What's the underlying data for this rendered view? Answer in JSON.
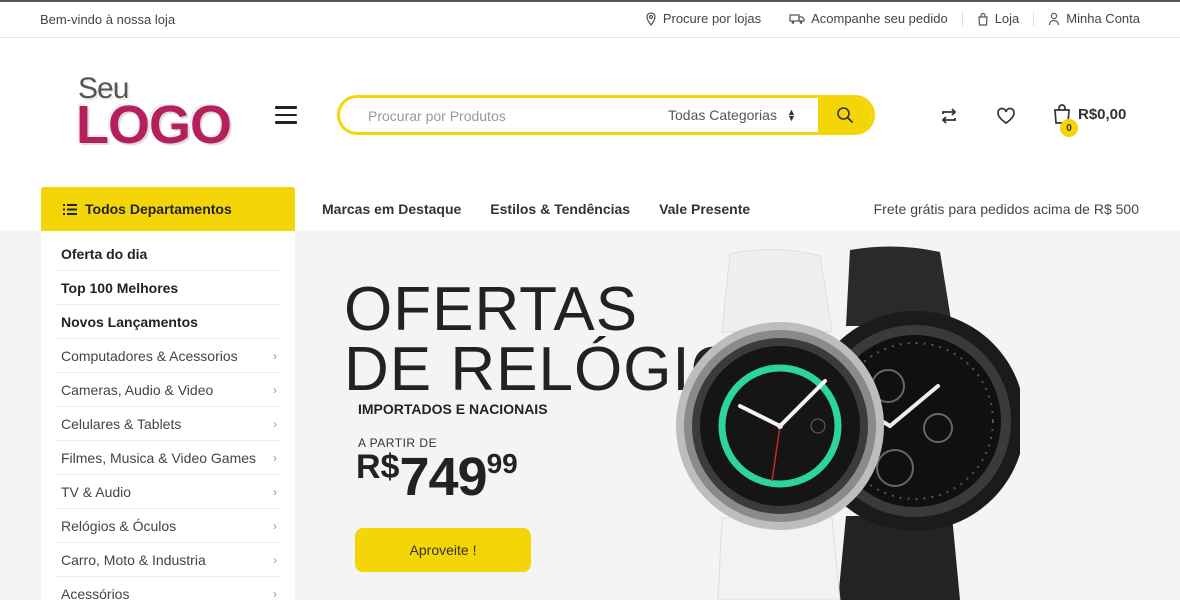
{
  "topbar": {
    "welcome": "Bem-vindo à nossa loja",
    "links": [
      {
        "label": "Procure por lojas",
        "icon": "map-pin-icon"
      },
      {
        "label": "Acompanhe seu pedido",
        "icon": "truck-icon"
      },
      {
        "label": "Loja",
        "icon": "shopping-bag-icon"
      },
      {
        "label": "Minha Conta",
        "icon": "user-icon"
      }
    ]
  },
  "logo": {
    "top": "Seu",
    "main": "LOGO"
  },
  "search": {
    "placeholder": "Procurar por Produtos",
    "category": "Todas Categorias"
  },
  "cart": {
    "count": "0",
    "total": "R$0,00"
  },
  "nav": {
    "departments_label": "Todos Departamentos",
    "links": [
      "Marcas em Destaque",
      "Estilos & Tendências",
      "Vale Presente"
    ],
    "free_shipping": "Frete grátis para pedidos acima de R$ 500"
  },
  "sidebar": {
    "items": [
      {
        "label": "Oferta do dia",
        "bold": true
      },
      {
        "label": "Top 100 Melhores",
        "bold": true
      },
      {
        "label": "Novos Lançamentos",
        "bold": true
      },
      {
        "label": "Computadores & Acessorios",
        "bold": false
      },
      {
        "label": "Cameras, Audio & Video",
        "bold": false
      },
      {
        "label": "Celulares & Tablets",
        "bold": false
      },
      {
        "label": "Filmes, Musica & Video Games",
        "bold": false
      },
      {
        "label": "TV & Audio",
        "bold": false
      },
      {
        "label": "Relógios & Óculos",
        "bold": false
      },
      {
        "label": "Carro, Moto & Industria",
        "bold": false
      },
      {
        "label": "Acessórios",
        "bold": false
      }
    ]
  },
  "promo": {
    "title_line1": "OFERTAS",
    "title_line2": "DE RELÓGIOS",
    "subtitle": "IMPORTADOS E NACIONAIS",
    "from_label": "A PARTIR DE",
    "currency": "R$",
    "price_int": "749",
    "price_cents": "99",
    "cta": "Aproveite !"
  },
  "colors": {
    "accent": "#f4d507",
    "brand": "#b51f5c",
    "watch_ring": "#2dd4a0"
  }
}
